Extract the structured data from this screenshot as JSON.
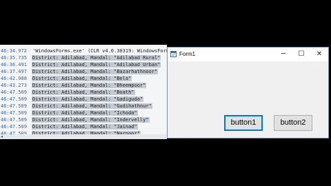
{
  "console": {
    "lines": [
      {
        "time": "46:34.972",
        "text": "'WindowsForms.exe' (CLR v4.0.30319: WindowsForms",
        "selected": false
      },
      {
        "time": "46:35.735",
        "text": "District: Adilabad, Mandal: \"Adilabad Rural\"",
        "selected": true
      },
      {
        "time": "46:36.491",
        "text": "District: Adilabad, Mandal: \"Adilabad Urban\"",
        "selected": true
      },
      {
        "time": "46:37.497",
        "text": "District: Adilabad, Mandal: \"Bazarhathnoor\"",
        "selected": true
      },
      {
        "time": "46:42.988",
        "text": "District: Adilabad, Mandal: \"Bela\"",
        "selected": true
      },
      {
        "time": "46:43.273",
        "text": "District: Adilabad, Mandal: \"Bheempoor\"",
        "selected": true
      },
      {
        "time": "46:47.509",
        "text": "District: Adilabad, Mandal: \"Boath\"",
        "selected": true
      },
      {
        "time": "46:47.509",
        "text": "District: Adilabad, Mandal: \"Gadiguda\"",
        "selected": true
      },
      {
        "time": "46:47.509",
        "text": "District: Adilabad, Mandal: \"Gudihathnur\"",
        "selected": true
      },
      {
        "time": "46:47.509",
        "text": "District: Adilabad, Mandal: \"Ichoda\"",
        "selected": true
      },
      {
        "time": "46:47.509",
        "text": "District: Adilabad, Mandal: \"Indervelly\"",
        "selected": true
      },
      {
        "time": "46:47.509",
        "text": "District: Adilabad, Mandal: \"Jainad\"",
        "selected": true
      },
      {
        "time": "46:47.509",
        "text": "District: Adilabad, Mandal: \"Narnoor\"",
        "selected": true
      },
      {
        "time": "46:47.509",
        "text": "District: Adilabad, Mandal: \"Neradigonda\"",
        "selected": true
      }
    ],
    "scroll_left_icon": "chevron-left-icon"
  },
  "window": {
    "title": "Form1",
    "app_icon": "form-app-icon",
    "minimize_glyph": "─",
    "maximize_glyph": "☐",
    "close_glyph": "✕",
    "button1_label": "button1",
    "button2_label": "button2",
    "accent_color": "#0078d7"
  },
  "colors": {
    "timestamp": "#2a64b6",
    "selection": "#c3c9d1",
    "background": "#000000"
  }
}
